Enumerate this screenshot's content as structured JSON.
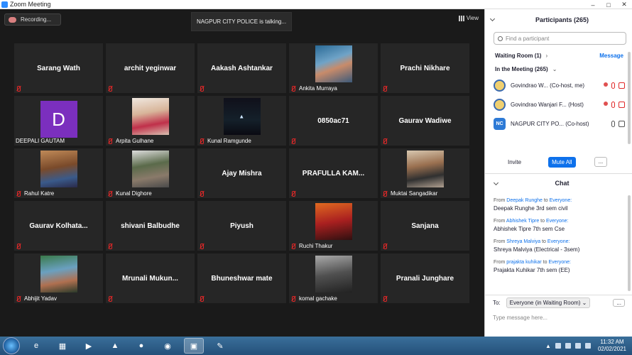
{
  "window": {
    "title": "Zoom Meeting"
  },
  "video": {
    "recording_label": "Recording...",
    "talking": "NAGPUR CITY POLICE is talking...",
    "view_label": "View"
  },
  "tiles": [
    {
      "name": "Sarang Wath",
      "kind": "name"
    },
    {
      "name": "archit yeginwar",
      "kind": "name"
    },
    {
      "name": "Aakash Ashtankar",
      "kind": "name"
    },
    {
      "name": "Ankita Murraya",
      "kind": "photo",
      "photo": "p1"
    },
    {
      "name": "Prachi Nikhare",
      "kind": "name"
    },
    {
      "name": "DEEPALI GAUTAM",
      "kind": "avatar",
      "initial": "D"
    },
    {
      "name": "Arpita Gulhane",
      "kind": "photo",
      "photo": "p2"
    },
    {
      "name": "Kunal Ramgunde",
      "kind": "logo",
      "logo": "kunal"
    },
    {
      "name": "0850ac71",
      "kind": "name"
    },
    {
      "name": "Gaurav Wadiwe",
      "kind": "name"
    },
    {
      "name": "Rahul Katre",
      "kind": "photo",
      "photo": "p4"
    },
    {
      "name": "Kunal Dighore",
      "kind": "photo",
      "photo": "p5"
    },
    {
      "name": "Ajay Mishra",
      "kind": "name"
    },
    {
      "name": "PRAFULLA KAM...",
      "kind": "name"
    },
    {
      "name": "Muktai Sangadikar",
      "kind": "photo",
      "photo": "p6"
    },
    {
      "name": "Gaurav  Kolhata...",
      "kind": "name"
    },
    {
      "name": "shivani Balbudhe",
      "kind": "name"
    },
    {
      "name": "Piyush",
      "kind": "name"
    },
    {
      "name": "Ruchi Thakur",
      "kind": "photo",
      "photo": "p7"
    },
    {
      "name": "Sanjana",
      "kind": "name"
    },
    {
      "name": "Abhijit Yadav",
      "kind": "photo",
      "photo": "p8"
    },
    {
      "name": "Mrunali  Mukun...",
      "kind": "name"
    },
    {
      "name": "Bhuneshwar mate",
      "kind": "name"
    },
    {
      "name": "komal gachake",
      "kind": "photo",
      "photo": "p9"
    },
    {
      "name": "Pranali Junghare",
      "kind": "name"
    }
  ],
  "panel": {
    "title": "Participants (265)",
    "search_placeholder": "Find a participant",
    "waiting_room": "Waiting Room (1)",
    "message": "Message",
    "in_meeting": "In the Meeting (265)",
    "participants": [
      {
        "name": "Govindrao W...",
        "role": "(Co-host, me)",
        "av": ""
      },
      {
        "name": "Govindrao Wanjari F...",
        "role": "(Host)",
        "av": ""
      },
      {
        "name": "NAGPUR CITY PO...",
        "role": "(Co-host)",
        "av": "NC"
      }
    ],
    "invite": "Invite",
    "mute_all": "Mute All",
    "more": "...",
    "chat_title": "Chat",
    "from_word": "From",
    "to_word": "to",
    "everyone": "Everyone:",
    "messages": [
      {
        "sender": "Deepak Runghe",
        "text": "Deepak Runghe 3rd sem civil"
      },
      {
        "sender": "Abhishek Tipre",
        "text": "Abhishek Tipre 7th sem Cse"
      },
      {
        "sender": "Shreya Malviya",
        "text": "Shreya Malviya (Electrical - 3sem)"
      },
      {
        "sender": "prajakta kuhikar",
        "text": "Prajakta Kuhikar 7th sem (EE)"
      }
    ],
    "to_label": "To:",
    "to_value": "Everyone (in Waiting Room)",
    "type_placeholder": "Type message here..."
  },
  "taskbar": {
    "time": "11:32 AM",
    "date": "02/02/2021"
  }
}
